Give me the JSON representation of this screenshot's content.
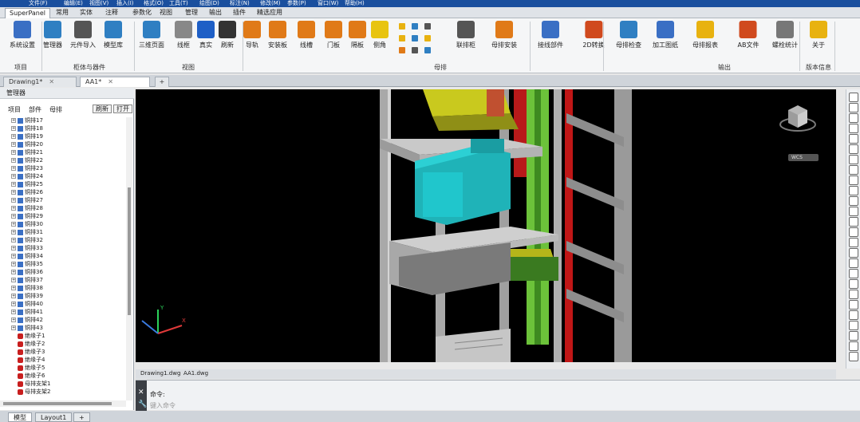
{
  "menubar": {
    "items": [
      "文件(F)",
      "编辑(E)",
      "视图(V)",
      "插入(I)",
      "格式(O)",
      "工具(T)",
      "绘图(D)",
      "标注(N)",
      "修改(M)",
      "参数(P)",
      "窗口(W)",
      "帮助(H)"
    ]
  },
  "ribbon_tabs": [
    {
      "label": "SuperPanel"
    },
    {
      "label": "常用"
    },
    {
      "label": "实体"
    },
    {
      "label": "注释"
    },
    {
      "label": "参数化"
    },
    {
      "label": "视图"
    },
    {
      "label": "管理"
    },
    {
      "label": "输出"
    },
    {
      "label": "插件"
    },
    {
      "label": "精选应用"
    }
  ],
  "ribbon": {
    "buttons": [
      {
        "label": "系统设置",
        "color": "#3a6fc4"
      },
      {
        "label": "管理器",
        "color": "#2f7fc2"
      },
      {
        "label": "元件导入",
        "color": "#555"
      },
      {
        "label": "模型库",
        "color": "#2f7fc2"
      },
      {
        "label": "三维页面",
        "color": "#2f7fc2"
      },
      {
        "label": "线框",
        "color": "#888"
      },
      {
        "label": "真实",
        "color": "#1e5fc6"
      },
      {
        "label": "刷新",
        "color": "#333"
      },
      {
        "label": "导轨",
        "color": "#e07a18"
      },
      {
        "label": "安装板",
        "color": "#e07a18"
      },
      {
        "label": "线槽",
        "color": "#e07a18"
      },
      {
        "label": "门板",
        "color": "#e07a18"
      },
      {
        "label": "隔板",
        "color": "#e07a18"
      },
      {
        "label": "侧角",
        "color": "#e8c410"
      },
      {
        "label": "联排柜",
        "color": "#555"
      },
      {
        "label": "母排安装",
        "color": "#e07a18"
      },
      {
        "label": "接线部件",
        "color": "#3a6fc4"
      },
      {
        "label": "2D转换",
        "color": "#d04a1e"
      },
      {
        "label": "母排检查",
        "color": "#2f7fc2"
      },
      {
        "label": "加工图纸",
        "color": "#3a6fc4"
      },
      {
        "label": "母排报表",
        "color": "#e8b210"
      },
      {
        "label": "AB文件",
        "color": "#d04a1e"
      },
      {
        "label": "螺栓统计",
        "color": "#777"
      },
      {
        "label": "关于",
        "color": "#e8b210"
      }
    ],
    "groups": [
      "项目",
      "柜体与器件",
      "视图",
      "母排",
      "输出",
      "版本信息"
    ]
  },
  "doc_tabs": [
    {
      "label": "Drawing1*"
    },
    {
      "label": "AA1*"
    }
  ],
  "manager": {
    "title": "管理器",
    "tabs": [
      "项目",
      "部件",
      "母排"
    ],
    "buttons": [
      "刷新",
      "打开"
    ],
    "tree": [
      "铜排17",
      "铜排18",
      "铜排19",
      "铜排20",
      "铜排21",
      "铜排22",
      "铜排23",
      "铜排24",
      "铜排25",
      "铜排26",
      "铜排27",
      "铜排28",
      "铜排29",
      "铜排30",
      "铜排31",
      "铜排32",
      "铜排33",
      "铜排34",
      "铜排35",
      "铜排36",
      "铜排37",
      "铜排38",
      "铜排39",
      "铜排40",
      "铜排41",
      "铜排42",
      "铜排43"
    ],
    "tree_red": [
      "绝缘子1",
      "绝缘子2",
      "绝缘子3",
      "绝缘子4",
      "绝缘子5",
      "绝缘子6",
      "母排支架1",
      "母排支架2"
    ]
  },
  "view": {
    "viewcube_label": "WCS"
  },
  "layout_files": [
    "Drawing1.dwg",
    "AA1.dwg"
  ],
  "command": {
    "label": "命令:",
    "placeholder": "键入命令"
  },
  "status_tabs": [
    "模型",
    "Layout1"
  ]
}
